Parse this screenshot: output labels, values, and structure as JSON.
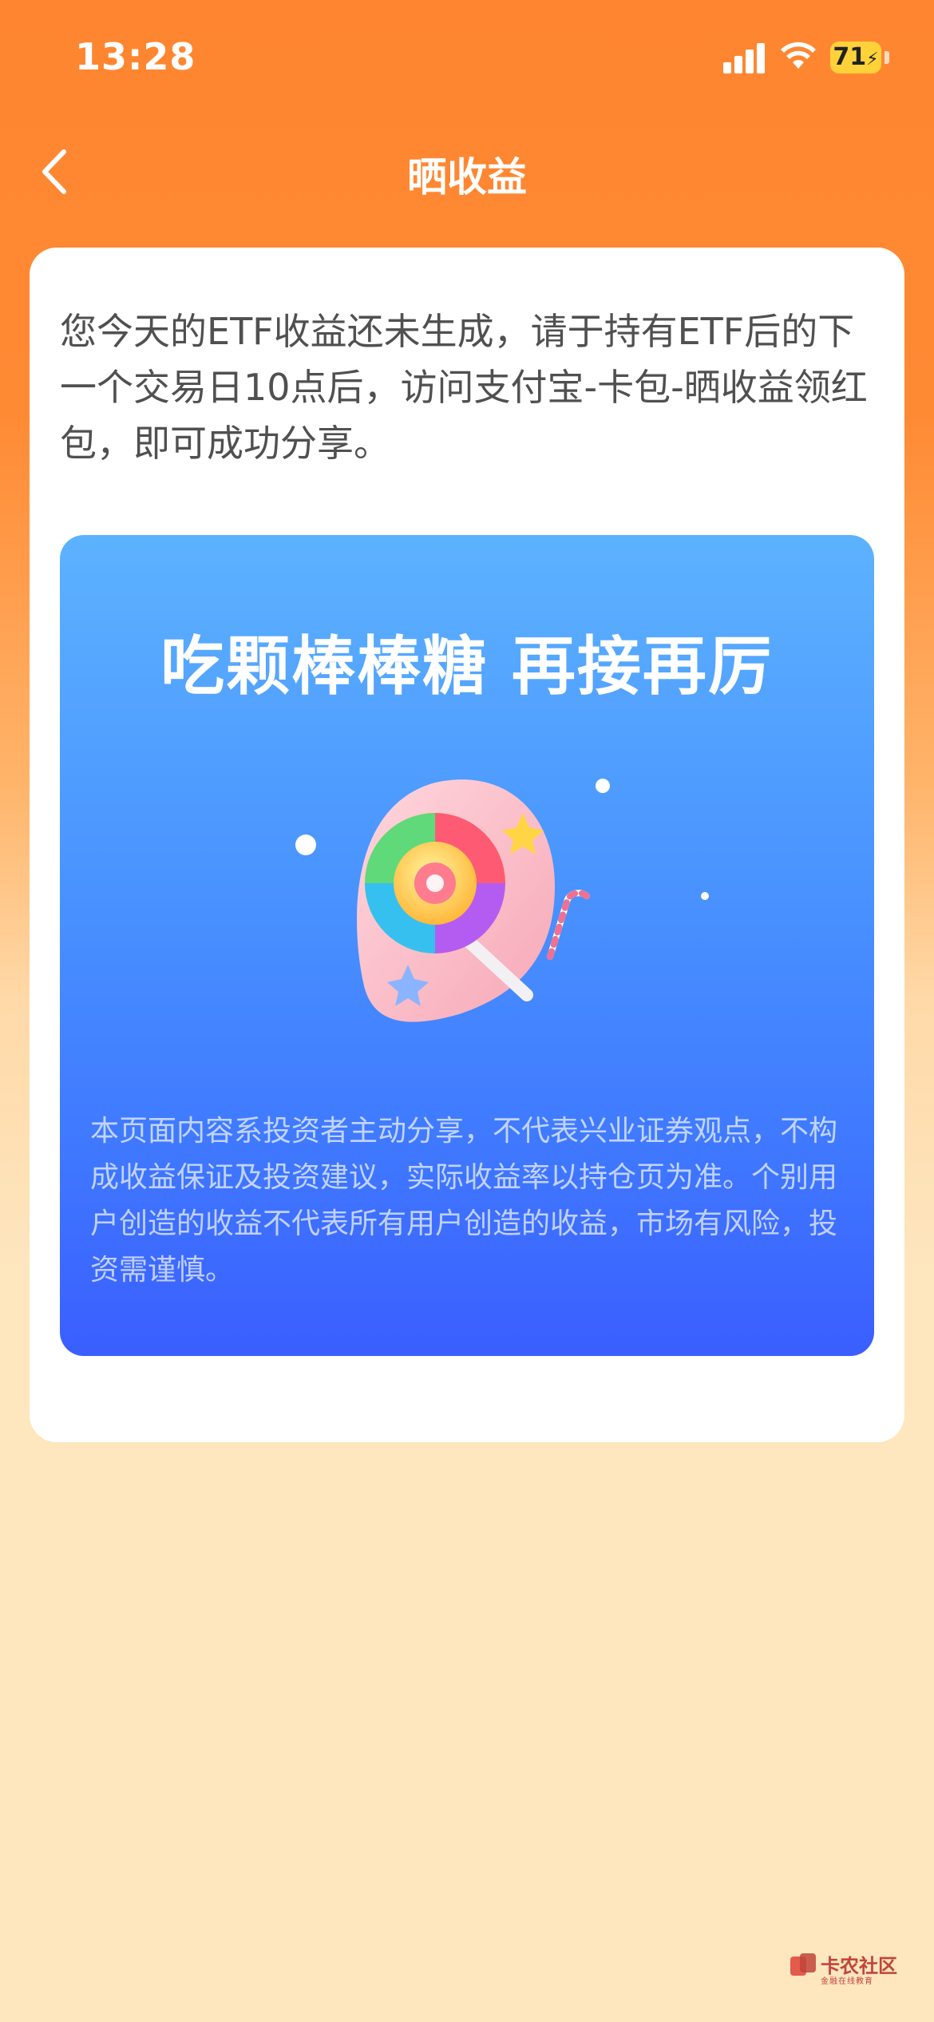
{
  "status_bar": {
    "time": "13:28",
    "battery": "71",
    "icons": [
      "cellular-signal-icon",
      "wifi-icon",
      "battery-charging-icon"
    ]
  },
  "nav": {
    "back_icon": "chevron-left-icon",
    "title": "晒收益"
  },
  "notice": "您今天的ETF收益还未生成，请于持有ETF后的下一个交易日10点后，访问支付宝-卡包-晒收益领红包，即可成功分享。",
  "share_card": {
    "headline": "吃颗棒棒糖 再接再厉",
    "illustration": "lollipop-illustration",
    "disclaimer": "本页面内容系投资者主动分享，不代表兴业证券观点，不构成收益保证及投资建议，实际收益率以持仓页为准。个别用户创造的收益不代表所有用户创造的收益，市场有风险，投资需谨慎。"
  },
  "watermark": {
    "text": "卡农社区",
    "subtext": "金融在线教育"
  },
  "colors": {
    "header_orange": "#ff8530",
    "background_cream": "#fee6bf",
    "card_blue_top": "#5db2ff",
    "card_blue_bottom": "#3a5eff",
    "battery_yellow": "#ffd23a"
  }
}
